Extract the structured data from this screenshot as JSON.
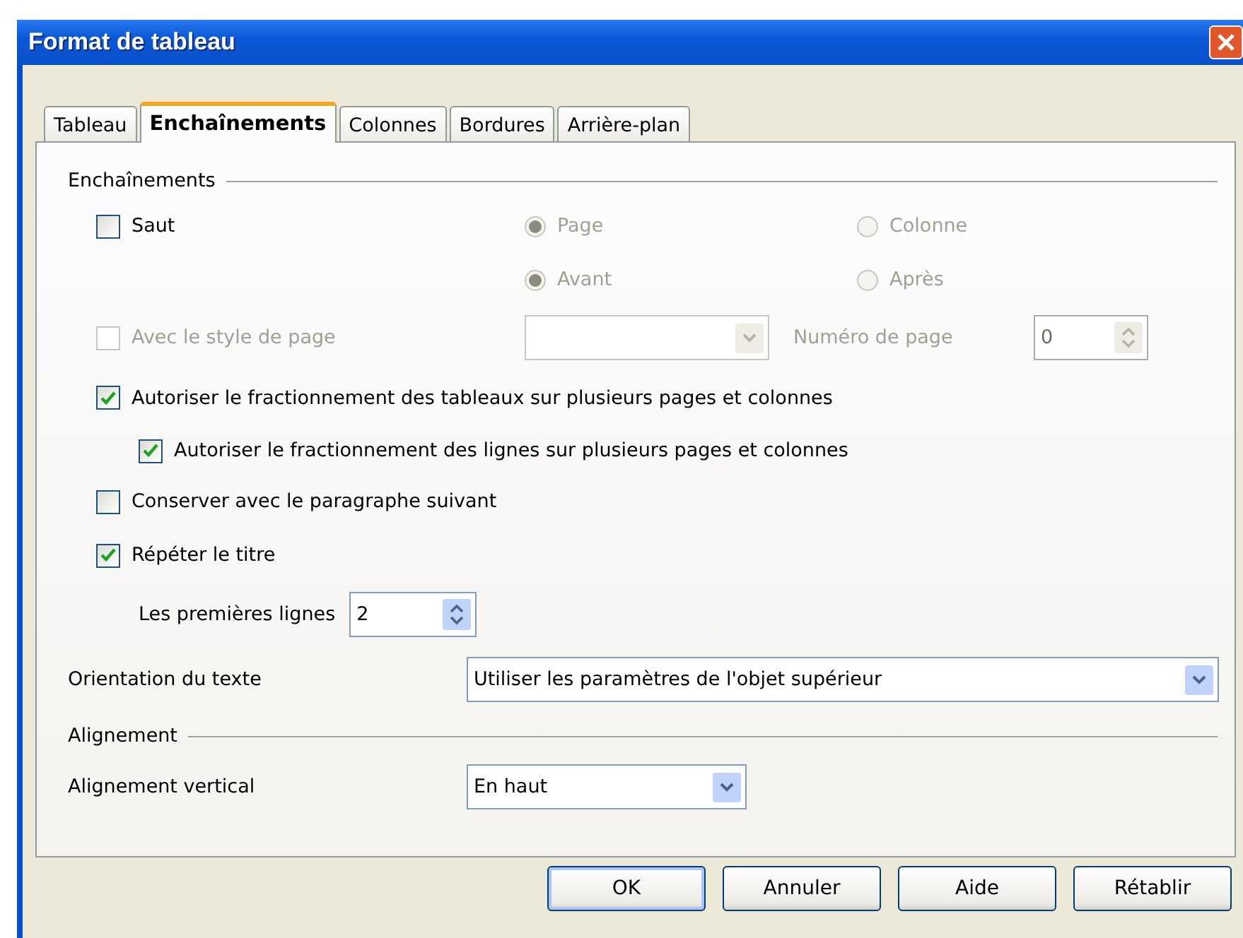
{
  "window": {
    "title": "Format de tableau"
  },
  "tabs": [
    {
      "label": "Tableau",
      "selected": false
    },
    {
      "label": "Enchaînements",
      "selected": true
    },
    {
      "label": "Colonnes",
      "selected": false
    },
    {
      "label": "Bordures",
      "selected": false
    },
    {
      "label": "Arrière-plan",
      "selected": false
    }
  ],
  "flow": {
    "title": "Enchaînements",
    "break": {
      "label": "Saut",
      "checked": false
    },
    "break_type": [
      {
        "label": "Page",
        "selected": true,
        "disabled": true
      },
      {
        "label": "Colonne",
        "selected": false,
        "disabled": true
      }
    ],
    "break_position": [
      {
        "label": "Avant",
        "selected": true,
        "disabled": true
      },
      {
        "label": "Après",
        "selected": false,
        "disabled": true
      }
    ],
    "page_style": {
      "label": "Avec le style de page",
      "checked": false,
      "disabled": true
    },
    "page_number": {
      "label": "Numéro de page",
      "value": "0",
      "disabled": true
    },
    "allow_table_split": {
      "label": "Autoriser le fractionnement des tableaux sur plusieurs pages et colonnes",
      "checked": true
    },
    "allow_row_split": {
      "label": "Autoriser le fractionnement des lignes sur plusieurs pages et colonnes",
      "checked": true
    },
    "keep_with_next": {
      "label": "Conserver avec le paragraphe suivant",
      "checked": false
    },
    "repeat_heading": {
      "label": "Répéter le titre",
      "checked": true
    },
    "first_rows": {
      "label": "Les premières lignes",
      "value": "2"
    },
    "text_direction": {
      "label": "Orientation du texte",
      "value": "Utiliser les paramètres de l'objet supérieur"
    }
  },
  "alignment": {
    "title": "Alignement",
    "vertical": {
      "label": "Alignement vertical",
      "value": "En haut"
    }
  },
  "buttons": [
    {
      "label": "OK",
      "default": true
    },
    {
      "label": "Annuler",
      "default": false
    },
    {
      "label": "Aide",
      "default": false
    },
    {
      "label": "Rétablir",
      "default": false
    }
  ]
}
